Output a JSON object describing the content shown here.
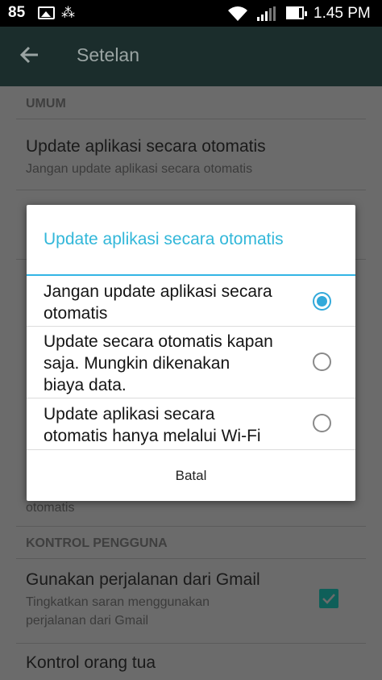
{
  "status_bar": {
    "battery_level": "85",
    "time": "1.45 PM"
  },
  "toolbar": {
    "title": "Setelan"
  },
  "settings": {
    "section_general": "UMUM",
    "auto_update": {
      "title": "Update aplikasi secara otomatis",
      "subtitle": "Jangan update aplikasi secara otomatis"
    },
    "partial_subtitle": "otomatis",
    "section_user_control": "KONTROL PENGGUNA",
    "gmail_trips": {
      "title": "Gunakan perjalanan dari Gmail",
      "subtitle_line1": "Tingkatkan saran menggunakan",
      "subtitle_line2": "perjalanan dari Gmail",
      "checked": true
    },
    "parental_control": {
      "title": "Kontrol orang tua"
    }
  },
  "dialog": {
    "title": "Update aplikasi secara otomatis",
    "options": [
      {
        "line1": "Jangan update aplikasi secara",
        "line2": "otomatis",
        "line3": "",
        "selected": true
      },
      {
        "line1": "Update secara otomatis kapan",
        "line2": "saja. Mungkin dikenakan",
        "line3": "biaya data.",
        "selected": false
      },
      {
        "line1": "Update aplikasi secara",
        "line2": "otomatis hanya melalui Wi-Fi",
        "line3": "",
        "selected": false
      }
    ],
    "cancel_label": "Batal"
  },
  "colors": {
    "accent": "#33b5e5",
    "toolbar_bg": "#1b2d2c",
    "checkbox": "#0f5f59"
  }
}
